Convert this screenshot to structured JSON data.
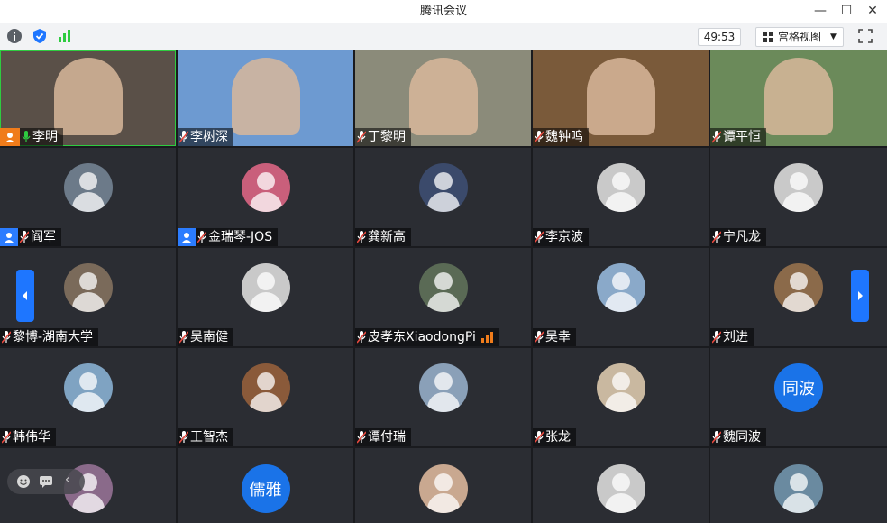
{
  "window": {
    "title": "腾讯会议"
  },
  "toolbar": {
    "timer": "49:53",
    "view_label": "宫格视图"
  },
  "colors": {
    "accent": "#1e76ff",
    "host_badge": "#2b7cff",
    "share_badge": "#f07c1b",
    "mic_active": "#2ecc40",
    "mic_muted": "#e8493f"
  },
  "participants": [
    {
      "name": "李明",
      "mic": "active",
      "badge": "orange"
    },
    {
      "name": "李树深",
      "mic": "muted"
    },
    {
      "name": "丁黎明",
      "mic": "muted"
    },
    {
      "name": "魏钟鸣",
      "mic": "muted"
    },
    {
      "name": "谭平恒",
      "mic": "muted"
    },
    {
      "name": "阎军",
      "mic": "muted",
      "badge": "host"
    },
    {
      "name": "金瑞琴-JOS",
      "mic": "muted",
      "badge": "host"
    },
    {
      "name": "龚新高",
      "mic": "muted"
    },
    {
      "name": "李京波",
      "mic": "muted"
    },
    {
      "name": "宁凡龙",
      "mic": "muted"
    },
    {
      "name": "黎博-湖南大学",
      "mic": "muted"
    },
    {
      "name": "吴南健",
      "mic": "muted"
    },
    {
      "name": "皮孝东XiaodongPi",
      "mic": "muted",
      "signal": true
    },
    {
      "name": "吴幸",
      "mic": "muted"
    },
    {
      "name": "刘进",
      "mic": "muted"
    },
    {
      "name": "韩伟华",
      "mic": "muted"
    },
    {
      "name": "王智杰",
      "mic": "muted"
    },
    {
      "name": "谭付瑞",
      "mic": "muted"
    },
    {
      "name": "张龙",
      "mic": "muted"
    },
    {
      "name": "魏同波",
      "mic": "muted",
      "avatar_text": "同波"
    },
    {
      "avatar_text": ""
    },
    {
      "avatar_text": "儒雅"
    },
    {
      "avatar_text": ""
    },
    {
      "avatar_text": ""
    },
    {
      "avatar_text": ""
    }
  ]
}
